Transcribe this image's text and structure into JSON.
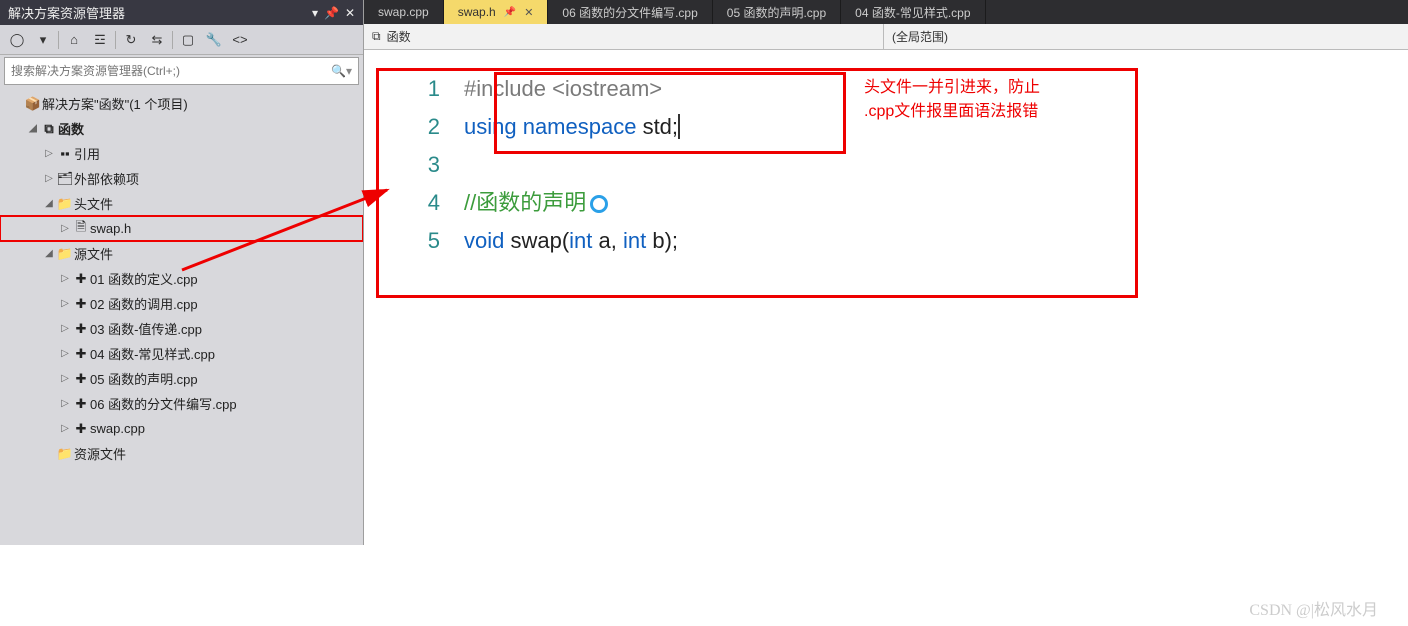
{
  "solution_explorer": {
    "title": "解决方案资源管理器",
    "search_placeholder": "搜索解决方案资源管理器(Ctrl+;)",
    "root": "解决方案\"函数\"(1 个项目)",
    "project": "函数",
    "references": "引用",
    "external": "外部依赖项",
    "headers_folder": "头文件",
    "header_file": "swap.h",
    "sources_folder": "源文件",
    "sources": [
      "01 函数的定义.cpp",
      "02 函数的调用.cpp",
      "03 函数-值传递.cpp",
      "04 函数-常见样式.cpp",
      "05 函数的声明.cpp",
      "06 函数的分文件编写.cpp",
      "swap.cpp"
    ],
    "resources_folder": "资源文件"
  },
  "tabs": [
    {
      "label": "swap.cpp",
      "active": false
    },
    {
      "label": "swap.h",
      "active": true
    },
    {
      "label": "06 函数的分文件编写.cpp",
      "active": false
    },
    {
      "label": "05 函数的声明.cpp",
      "active": false
    },
    {
      "label": "04 函数-常见样式.cpp",
      "active": false
    }
  ],
  "context": {
    "left": "函数",
    "right": "(全局范围)"
  },
  "code": {
    "l1": "#include <iostream>",
    "l2_pre": "using namespace",
    "l2_rest": " std;",
    "l4": "//函数的声明",
    "l5_void": "void",
    "l5_name": " swap(",
    "l5_t1": "int",
    "l5_a": " a, ",
    "l5_t2": "int",
    "l5_b": " b);"
  },
  "annotation": {
    "line1": "头文件一并引进来，防止",
    "line2": ".cpp文件报里面语法报错"
  },
  "watermark": "CSDN @|松风水月"
}
